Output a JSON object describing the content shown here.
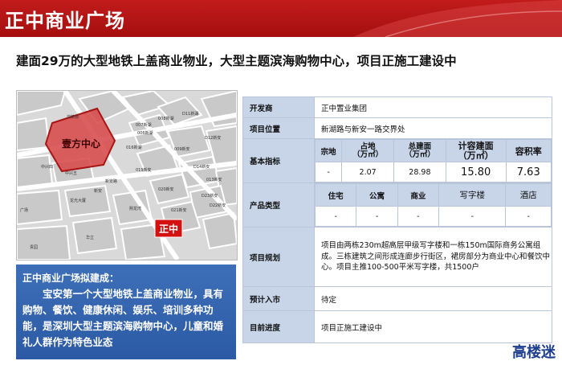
{
  "header": {
    "title": "正中商业广场"
  },
  "subtitle": "建面29万的大型地铁上盖商业物业，大型主题滨海购物中心，项目正施工建设中",
  "map": {
    "block_label": "壹方中心",
    "marker_label": "正中",
    "street_labels": [
      "鸿荣源",
      "006新湖",
      "007新湖",
      "008新湖",
      "D11新湖",
      "009新安",
      "D12新安",
      "013新安",
      "D14新安",
      "016新湖",
      "019新安",
      "020新安",
      "021新安",
      "D22新安",
      "D23新安",
      "中兴五",
      "中兴四",
      "龙光大厦",
      "新安",
      "新安路",
      "熙龙湾",
      "华立",
      "贵园",
      "广场"
    ]
  },
  "description": {
    "title": "正中商业广场拟建成：",
    "body": "宝安第一个大型地铁上盖商业物业，具有购物、餐饮、健康休闲、娱乐、培训多种功能，是深圳大型主题滨海购物中心，儿童和婚礼人群作为特色业态"
  },
  "table": {
    "developer": {
      "key": "开发商",
      "value": "正中置业集团"
    },
    "location": {
      "key": "项目位置",
      "value": "新湖路与新安一路交界处"
    },
    "basic": {
      "key": "基本指标",
      "headers": [
        "宗地",
        "占地\n（万㎡）",
        "总建面\n（万㎡）",
        "计容建面\n（万㎡）",
        "容积率"
      ],
      "values": [
        "-",
        "2.07",
        "28.98",
        "15.80",
        "7.63"
      ]
    },
    "product": {
      "key": "产品类型",
      "headers": [
        "住宅",
        "公寓",
        "商业",
        "写字楼",
        "酒店"
      ],
      "values": [
        "-",
        "-",
        "-",
        "-",
        "-"
      ]
    },
    "plan": {
      "key": "项目规划",
      "value": "项目由两栋230m超高层甲级写字楼和一栋150m国际商务公寓组成。三栋建筑之间形成连廊步行街区，裙房部分为商业中心和餐饮中心。项目主推100-500平米写字楼，共1500户"
    },
    "entry": {
      "key": "预计入市",
      "value": "待定"
    },
    "progress": {
      "key": "目前进度",
      "value": "项目正施工建设中"
    }
  },
  "watermark": "高楼迷"
}
